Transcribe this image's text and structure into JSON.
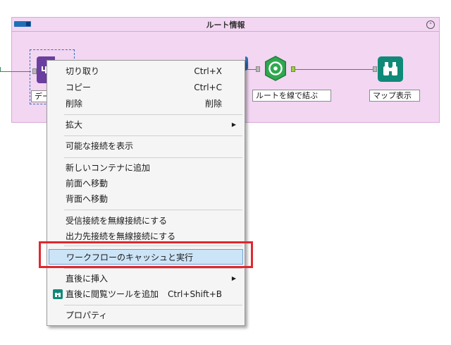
{
  "container": {
    "title": "ルート情報",
    "collapse_glyph": "⌃"
  },
  "tools": {
    "first_label": "デー",
    "route_label": "ルートを線で結ぶ",
    "map_label": "マップ表示"
  },
  "colors": {
    "container_bg": "#f2d6f2",
    "menu_highlight": "#cce4f7",
    "red_box": "#e0282e",
    "route_tool": "#2fa84f",
    "map_tool": "#0f8a78",
    "first_tool": "#6b3fa0"
  },
  "menu": {
    "items": [
      {
        "label": "切り取り",
        "shortcut": "Ctrl+X"
      },
      {
        "label": "コピー",
        "shortcut": "Ctrl+C"
      },
      {
        "label": "削除",
        "shortcut": "削除"
      },
      {
        "label": "拡大",
        "submenu": "▶"
      },
      {
        "label": "可能な接続を表示"
      },
      {
        "label": "新しいコンテナに追加"
      },
      {
        "label": "前面へ移動"
      },
      {
        "label": "背面へ移動"
      },
      {
        "label": "受信接続を無線接続にする"
      },
      {
        "label": "出力先接続を無線接続にする"
      },
      {
        "label": "ワークフローのキャッシュと実行"
      },
      {
        "label": "直後に挿入",
        "submenu": "▶"
      },
      {
        "label": "直後に閲覧ツールを追加",
        "shortcut": "Ctrl+Shift+B",
        "icon": "binoculars-icon"
      },
      {
        "label": "プロパティ"
      }
    ]
  }
}
